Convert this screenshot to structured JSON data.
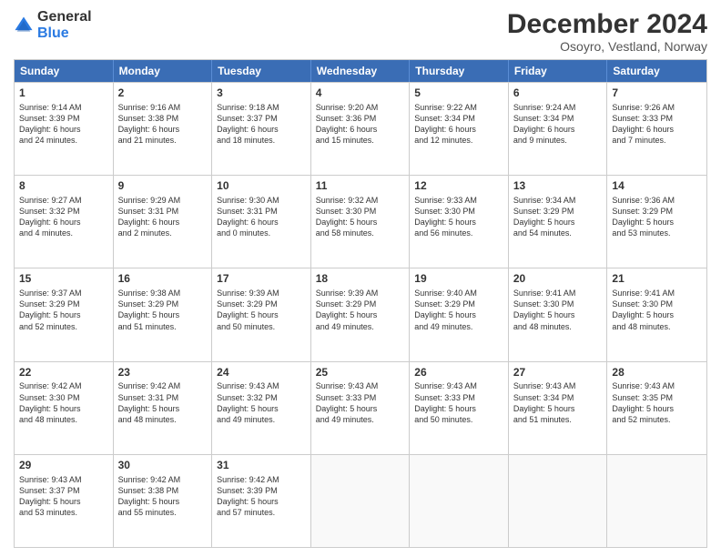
{
  "logo": {
    "general": "General",
    "blue": "Blue"
  },
  "title": "December 2024",
  "subtitle": "Osoyro, Vestland, Norway",
  "days": [
    "Sunday",
    "Monday",
    "Tuesday",
    "Wednesday",
    "Thursday",
    "Friday",
    "Saturday"
  ],
  "weeks": [
    [
      {
        "day": "1",
        "text": "Sunrise: 9:14 AM\nSunset: 3:39 PM\nDaylight: 6 hours\nand 24 minutes."
      },
      {
        "day": "2",
        "text": "Sunrise: 9:16 AM\nSunset: 3:38 PM\nDaylight: 6 hours\nand 21 minutes."
      },
      {
        "day": "3",
        "text": "Sunrise: 9:18 AM\nSunset: 3:37 PM\nDaylight: 6 hours\nand 18 minutes."
      },
      {
        "day": "4",
        "text": "Sunrise: 9:20 AM\nSunset: 3:36 PM\nDaylight: 6 hours\nand 15 minutes."
      },
      {
        "day": "5",
        "text": "Sunrise: 9:22 AM\nSunset: 3:34 PM\nDaylight: 6 hours\nand 12 minutes."
      },
      {
        "day": "6",
        "text": "Sunrise: 9:24 AM\nSunset: 3:34 PM\nDaylight: 6 hours\nand 9 minutes."
      },
      {
        "day": "7",
        "text": "Sunrise: 9:26 AM\nSunset: 3:33 PM\nDaylight: 6 hours\nand 7 minutes."
      }
    ],
    [
      {
        "day": "8",
        "text": "Sunrise: 9:27 AM\nSunset: 3:32 PM\nDaylight: 6 hours\nand 4 minutes."
      },
      {
        "day": "9",
        "text": "Sunrise: 9:29 AM\nSunset: 3:31 PM\nDaylight: 6 hours\nand 2 minutes."
      },
      {
        "day": "10",
        "text": "Sunrise: 9:30 AM\nSunset: 3:31 PM\nDaylight: 6 hours\nand 0 minutes."
      },
      {
        "day": "11",
        "text": "Sunrise: 9:32 AM\nSunset: 3:30 PM\nDaylight: 5 hours\nand 58 minutes."
      },
      {
        "day": "12",
        "text": "Sunrise: 9:33 AM\nSunset: 3:30 PM\nDaylight: 5 hours\nand 56 minutes."
      },
      {
        "day": "13",
        "text": "Sunrise: 9:34 AM\nSunset: 3:29 PM\nDaylight: 5 hours\nand 54 minutes."
      },
      {
        "day": "14",
        "text": "Sunrise: 9:36 AM\nSunset: 3:29 PM\nDaylight: 5 hours\nand 53 minutes."
      }
    ],
    [
      {
        "day": "15",
        "text": "Sunrise: 9:37 AM\nSunset: 3:29 PM\nDaylight: 5 hours\nand 52 minutes."
      },
      {
        "day": "16",
        "text": "Sunrise: 9:38 AM\nSunset: 3:29 PM\nDaylight: 5 hours\nand 51 minutes."
      },
      {
        "day": "17",
        "text": "Sunrise: 9:39 AM\nSunset: 3:29 PM\nDaylight: 5 hours\nand 50 minutes."
      },
      {
        "day": "18",
        "text": "Sunrise: 9:39 AM\nSunset: 3:29 PM\nDaylight: 5 hours\nand 49 minutes."
      },
      {
        "day": "19",
        "text": "Sunrise: 9:40 AM\nSunset: 3:29 PM\nDaylight: 5 hours\nand 49 minutes."
      },
      {
        "day": "20",
        "text": "Sunrise: 9:41 AM\nSunset: 3:30 PM\nDaylight: 5 hours\nand 48 minutes."
      },
      {
        "day": "21",
        "text": "Sunrise: 9:41 AM\nSunset: 3:30 PM\nDaylight: 5 hours\nand 48 minutes."
      }
    ],
    [
      {
        "day": "22",
        "text": "Sunrise: 9:42 AM\nSunset: 3:30 PM\nDaylight: 5 hours\nand 48 minutes."
      },
      {
        "day": "23",
        "text": "Sunrise: 9:42 AM\nSunset: 3:31 PM\nDaylight: 5 hours\nand 48 minutes."
      },
      {
        "day": "24",
        "text": "Sunrise: 9:43 AM\nSunset: 3:32 PM\nDaylight: 5 hours\nand 49 minutes."
      },
      {
        "day": "25",
        "text": "Sunrise: 9:43 AM\nSunset: 3:33 PM\nDaylight: 5 hours\nand 49 minutes."
      },
      {
        "day": "26",
        "text": "Sunrise: 9:43 AM\nSunset: 3:33 PM\nDaylight: 5 hours\nand 50 minutes."
      },
      {
        "day": "27",
        "text": "Sunrise: 9:43 AM\nSunset: 3:34 PM\nDaylight: 5 hours\nand 51 minutes."
      },
      {
        "day": "28",
        "text": "Sunrise: 9:43 AM\nSunset: 3:35 PM\nDaylight: 5 hours\nand 52 minutes."
      }
    ],
    [
      {
        "day": "29",
        "text": "Sunrise: 9:43 AM\nSunset: 3:37 PM\nDaylight: 5 hours\nand 53 minutes."
      },
      {
        "day": "30",
        "text": "Sunrise: 9:42 AM\nSunset: 3:38 PM\nDaylight: 5 hours\nand 55 minutes."
      },
      {
        "day": "31",
        "text": "Sunrise: 9:42 AM\nSunset: 3:39 PM\nDaylight: 5 hours\nand 57 minutes."
      },
      {
        "day": "",
        "text": ""
      },
      {
        "day": "",
        "text": ""
      },
      {
        "day": "",
        "text": ""
      },
      {
        "day": "",
        "text": ""
      }
    ]
  ]
}
